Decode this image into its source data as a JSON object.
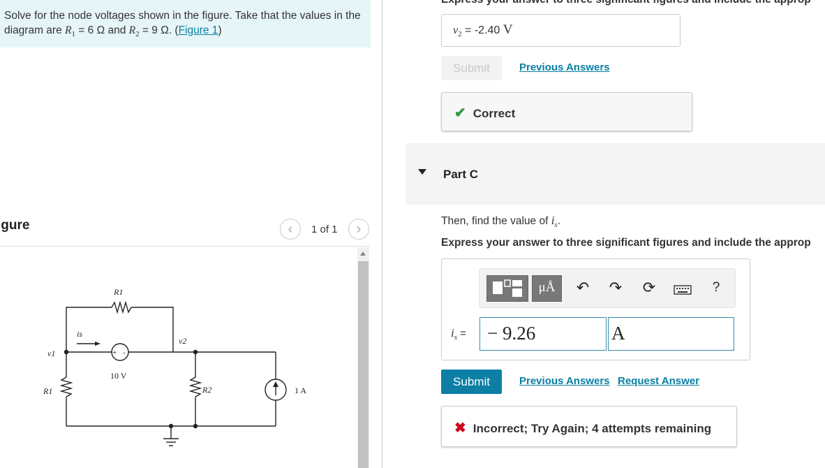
{
  "problem": {
    "text_before": "Solve for the node voltages shown in the figure. Take that the values in the diagram are ",
    "r1_symbol": "R",
    "r1_sub": "1",
    "r1_value": " = 6 Ω and ",
    "r2_symbol": "R",
    "r2_sub": "2",
    "r2_value": " = 9 Ω. (",
    "figure_link": "Figure 1",
    "text_after": ")"
  },
  "figure_panel": {
    "header": "igure",
    "counter": "1 of 1",
    "prev_icon": "chevron-left-icon",
    "next_icon": "chevron-right-icon"
  },
  "circuit": {
    "r1_top": "R1",
    "r1_left": "R1",
    "r2": "R2",
    "is": "is",
    "v1": "v1",
    "v2": "v2",
    "source_voltage": "10 V",
    "source_current": "1 A",
    "plus": "+",
    "minus": "-"
  },
  "part_b": {
    "header_cut": "Express your answer to three significant figures and include the approp",
    "answer_var": "v",
    "answer_sub": "2",
    "answer_eq": " = ",
    "answer_value": "-2.40",
    "answer_unit": "V",
    "submit_label": "Submit",
    "previous_answers": "Previous Answers",
    "feedback": "Correct"
  },
  "part_c": {
    "title": "Part C",
    "question_prefix": "Then, find the value of ",
    "question_var": "i",
    "question_sub": "s",
    "question_suffix": ".",
    "express": "Express your answer to three significant figures and include the approp",
    "toolbar": {
      "templates_icon": "templates-icon",
      "units_label": "μÅ",
      "undo_icon": "undo-icon",
      "redo_icon": "redo-icon",
      "reset_icon": "reset-icon",
      "keyboard_icon": "keyboard-icon",
      "help_label": "?"
    },
    "input_var": "i",
    "input_sub": "s",
    "input_eq": " =",
    "value": "− 9.26",
    "unit": "A",
    "submit_label": "Submit",
    "previous_answers": "Previous Answers",
    "request_answer": "Request Answer",
    "feedback": "Incorrect; Try Again; 4 attempts remaining"
  },
  "colors": {
    "problem_bg": "#e6f5f7",
    "link": "#0a7fa3",
    "submit": "#0d7fa5",
    "correct": "#2a9d3a",
    "incorrect": "#d0021b"
  }
}
